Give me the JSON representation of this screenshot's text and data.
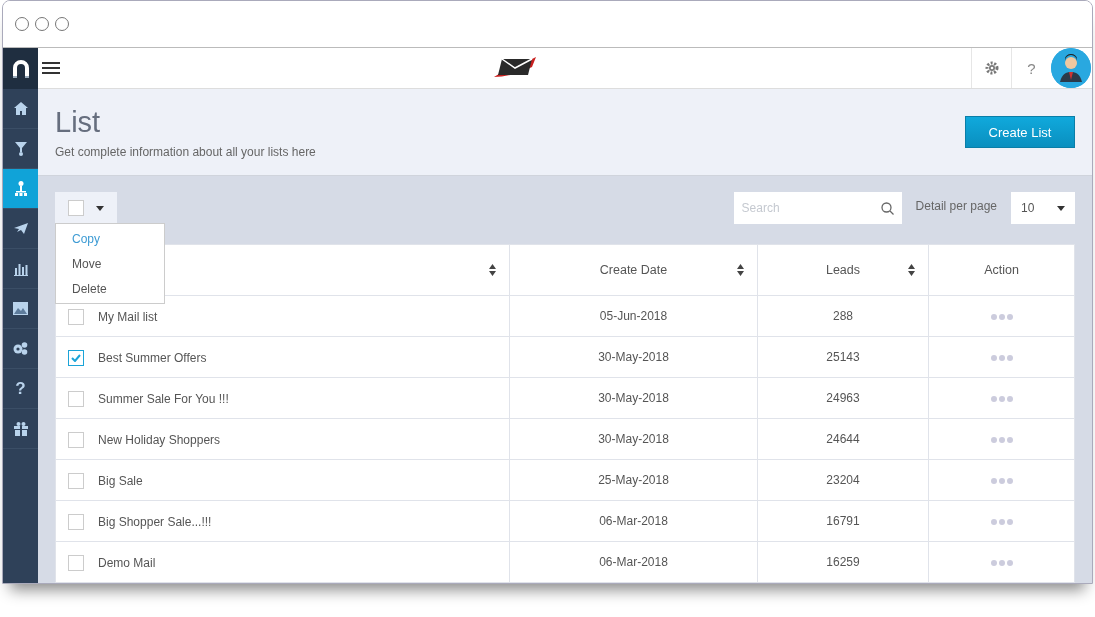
{
  "sidebar": {
    "items": [
      {
        "kind": "home",
        "selected": false
      },
      {
        "kind": "funnel",
        "selected": false
      },
      {
        "kind": "sitemap",
        "selected": true
      },
      {
        "kind": "plane",
        "selected": false
      },
      {
        "kind": "chart",
        "selected": false
      },
      {
        "kind": "image",
        "selected": false
      },
      {
        "kind": "gears",
        "selected": false
      },
      {
        "kind": "help",
        "selected": false,
        "label": "?"
      },
      {
        "kind": "gift",
        "selected": false
      }
    ]
  },
  "topbar": {
    "help": "?"
  },
  "header": {
    "title": "List",
    "subtitle": "Get complete information about all your lists here",
    "button": "Create List"
  },
  "toolbar": {
    "select_all_checked": false,
    "menu": [
      {
        "label": "Copy",
        "selected": true
      },
      {
        "label": "Move",
        "selected": false
      },
      {
        "label": "Delete",
        "selected": false
      }
    ],
    "search": {
      "placeholder": "Search"
    },
    "per_page_label": "Detail per page",
    "per_page": "10"
  },
  "table": {
    "columns": [
      {
        "sortable": true
      },
      {
        "label": "Create Date",
        "sortable": true
      },
      {
        "label": "Leads",
        "sortable": true
      },
      {
        "label": "Action",
        "sortable": false
      }
    ],
    "rows": [
      {
        "name": "My Mail list",
        "date": "05-Jun-2018",
        "leads": "288",
        "checked": false
      },
      {
        "name": "Best Summer Offers",
        "date": "30-May-2018",
        "leads": "25143",
        "checked": true
      },
      {
        "name": "Summer Sale For You !!!",
        "date": "30-May-2018",
        "leads": "24963",
        "checked": false
      },
      {
        "name": "New Holiday Shoppers",
        "date": "30-May-2018",
        "leads": "24644",
        "checked": false
      },
      {
        "name": "Big Sale",
        "date": "25-May-2018",
        "leads": "23204",
        "checked": false
      },
      {
        "name": "Big Shopper Sale...!!!",
        "date": "06-Mar-2018",
        "leads": "16791",
        "checked": false
      },
      {
        "name": "Demo Mail",
        "date": "06-Mar-2018",
        "leads": "16259",
        "checked": false
      }
    ]
  }
}
